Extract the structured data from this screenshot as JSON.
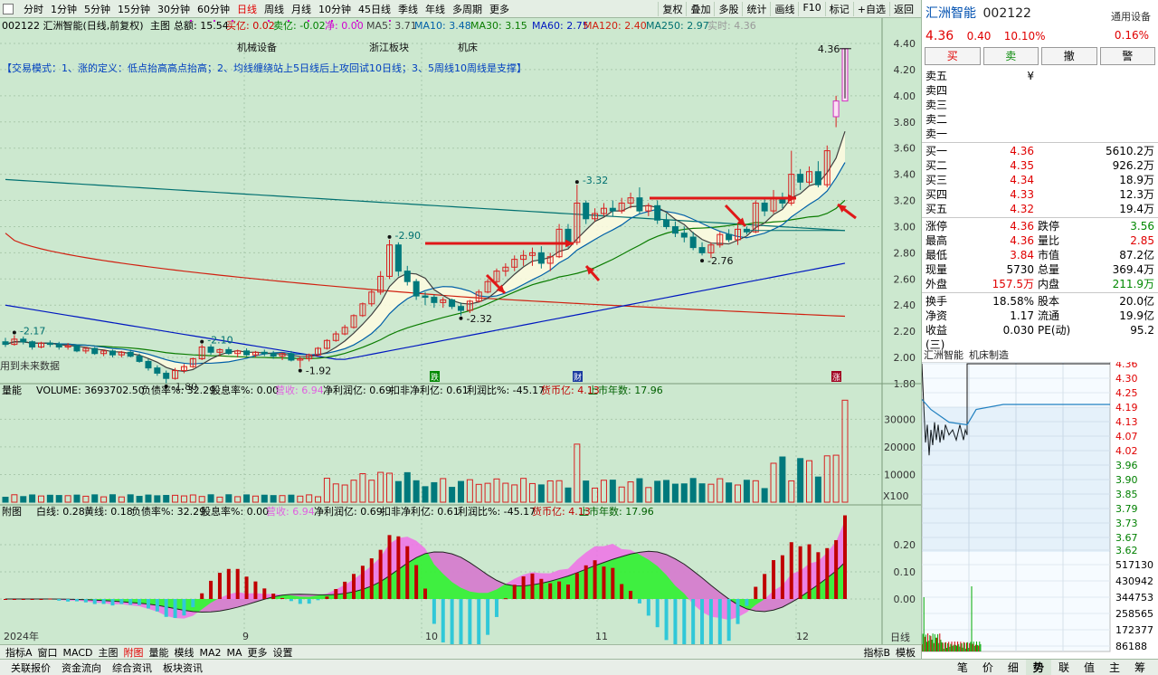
{
  "toolbar": {
    "periods": [
      "分时",
      "1分钟",
      "5分钟",
      "15分钟",
      "30分钟",
      "60分钟",
      "日线",
      "周线",
      "月线",
      "10分钟",
      "45日线",
      "季线",
      "年线",
      "多周期",
      "更多"
    ],
    "active": "日线",
    "right": [
      "复权",
      "叠加",
      "多股",
      "统计",
      "画线",
      "F10",
      "标记",
      "+自选",
      "返回"
    ]
  },
  "info_line": {
    "title": "002122 汇洲智能(日线,前复权)",
    "main": "主图",
    "zonge": "总额: 15.54",
    "maiyi": "买亿: 0.02",
    "maiyi2": "卖亿: -0.02",
    "jing": "净: 0.00",
    "ma5": "MA5: 3.71",
    "ma10": "MA10: 3.48",
    "ma30": "MA30: 3.15",
    "ma60": "MA60: 2.75",
    "ma120": "MA120: 2.40",
    "ma250": "MA250: 2.97",
    "shiji": "实时: 4.36"
  },
  "labels": {
    "tag1": "机械设备",
    "tag2": "浙江板块",
    "tag3": "机床",
    "note": "【交易模式：1、涨的定义：低点抬高高点抬高；2、均线缠绕站上5日线后上攻回试10日线；3、5周线10周线是支撑】",
    "future": "用到未来数据",
    "m_die": "跌",
    "m_cai": "财",
    "m_zhang": "涨"
  },
  "colors": {
    "ma5": "#404040",
    "ma10": "#0060a8",
    "ma30": "#0a7c00",
    "ma60": "#0018c0",
    "ma120": "#d02010",
    "ma250": "#007070",
    "up": "#d82020",
    "down": "#00797c",
    "bg": "#cce8cf"
  },
  "vol_line": {
    "a": "量能",
    "b": "VOLUME: 3693702.50",
    "c": "负债率%: 32.29",
    "d": "股息率%: 0.00",
    "e": "营收: 6.94",
    "f": "净利润亿: 0.69",
    "g": "扣非净利亿: 0.61",
    "h": "利润比%: -45.17",
    "i": "货币亿: 4.13",
    "j": "上市年数: 17.96",
    "unit": "X100"
  },
  "sub_line": {
    "a": "附图",
    "b": "白线: 0.28",
    "c": "黄线: 0.18",
    "d": "负债率%: 32.29",
    "e": "股息率%: 0.00",
    "f": "营收: 6.94",
    "g": "净利润亿: 0.69",
    "h": "扣非净利亿: 0.61",
    "i": "利润比%: -45.17",
    "j": "货币亿: 4.13",
    "k": "上市年数: 17.96"
  },
  "bottom": {
    "items": [
      "指标A",
      "窗口",
      "MACD",
      "主图",
      "附图",
      "量能",
      "模线",
      "MA2",
      "MA",
      "更多",
      "设置"
    ],
    "active": "附图",
    "right": [
      "指标B",
      "模板"
    ],
    "period": "日线"
  },
  "bottom2": {
    "items": [
      "关联报价",
      "资金流向",
      "综合资讯",
      "板块资讯"
    ],
    "tabs": [
      "笔",
      "价",
      "细",
      "势",
      "联",
      "值",
      "主",
      "筹"
    ],
    "active": "势"
  },
  "panel": {
    "name": "汇洲智能",
    "code": "002122",
    "setting": "通用设备",
    "price": "4.36",
    "change": "0.40",
    "pct": "10.10%",
    "pct2": "0.16%",
    "btn_buy": "买",
    "btn_sell": "卖",
    "btn_cancel": "撤",
    "btn_warn": "警",
    "sells": [
      {
        "l": "卖五",
        "p": "¥",
        "v": ""
      },
      {
        "l": "卖四",
        "p": "",
        "v": ""
      },
      {
        "l": "卖三",
        "p": "",
        "v": ""
      },
      {
        "l": "卖二",
        "p": "",
        "v": ""
      },
      {
        "l": "卖一",
        "p": "",
        "v": ""
      }
    ],
    "buys": [
      {
        "l": "买一",
        "p": "4.36",
        "v": "5610.2万"
      },
      {
        "l": "买二",
        "p": "4.35",
        "v": "926.2万"
      },
      {
        "l": "买三",
        "p": "4.34",
        "v": "18.9万"
      },
      {
        "l": "买四",
        "p": "4.33",
        "v": "12.3万"
      },
      {
        "l": "买五",
        "p": "4.32",
        "v": "19.4万"
      }
    ],
    "stats": [
      [
        "涨停",
        "4.36",
        "跌停",
        "3.56"
      ],
      [
        "最高",
        "4.36",
        "量比",
        "2.85"
      ],
      [
        "最低",
        "3.84",
        "市值",
        "87.2亿"
      ],
      [
        "现量",
        "5730",
        "总量",
        "369.4万"
      ],
      [
        "外盘",
        "157.5万",
        "内盘",
        "211.9万"
      ]
    ],
    "stats2": [
      [
        "换手",
        "18.58%",
        "股本",
        "20.0亿"
      ],
      [
        "净资",
        "1.17",
        "流通",
        "19.9亿"
      ],
      [
        "收益(三)",
        "0.030",
        "PE(动)",
        "95.2"
      ]
    ],
    "mini_title": "汇洲智能",
    "mini_sub": "机床制造"
  },
  "chart_data": {
    "type": "candlestick",
    "yaxis": [
      "4.40",
      "4.20",
      "4.00",
      "3.80",
      "3.60",
      "3.40",
      "3.20",
      "3.00",
      "2.80",
      "2.60",
      "2.40",
      "2.20",
      "2.00",
      "1.80"
    ],
    "ylim": [
      1.8,
      4.4
    ],
    "xaxis": [
      "2024年",
      "9",
      "10",
      "11",
      "12"
    ],
    "annotations": [
      "2.17",
      "2.10",
      "1.80",
      "1.92",
      "2.90",
      "2.32",
      "3.32",
      "2.76",
      "4.36"
    ],
    "vol_axis": [
      "30000",
      "20000",
      "10000"
    ],
    "sub_axis": [
      "0.20",
      "0.10",
      "0.00"
    ],
    "mini_axis": [
      "4.36",
      "4.30",
      "4.25",
      "4.19",
      "4.13",
      "4.07",
      "4.02",
      "3.96",
      "3.90",
      "3.85",
      "3.79",
      "3.73",
      "3.67",
      "3.62",
      "517130",
      "430942",
      "344753",
      "258565",
      "172377",
      "86188"
    ]
  }
}
